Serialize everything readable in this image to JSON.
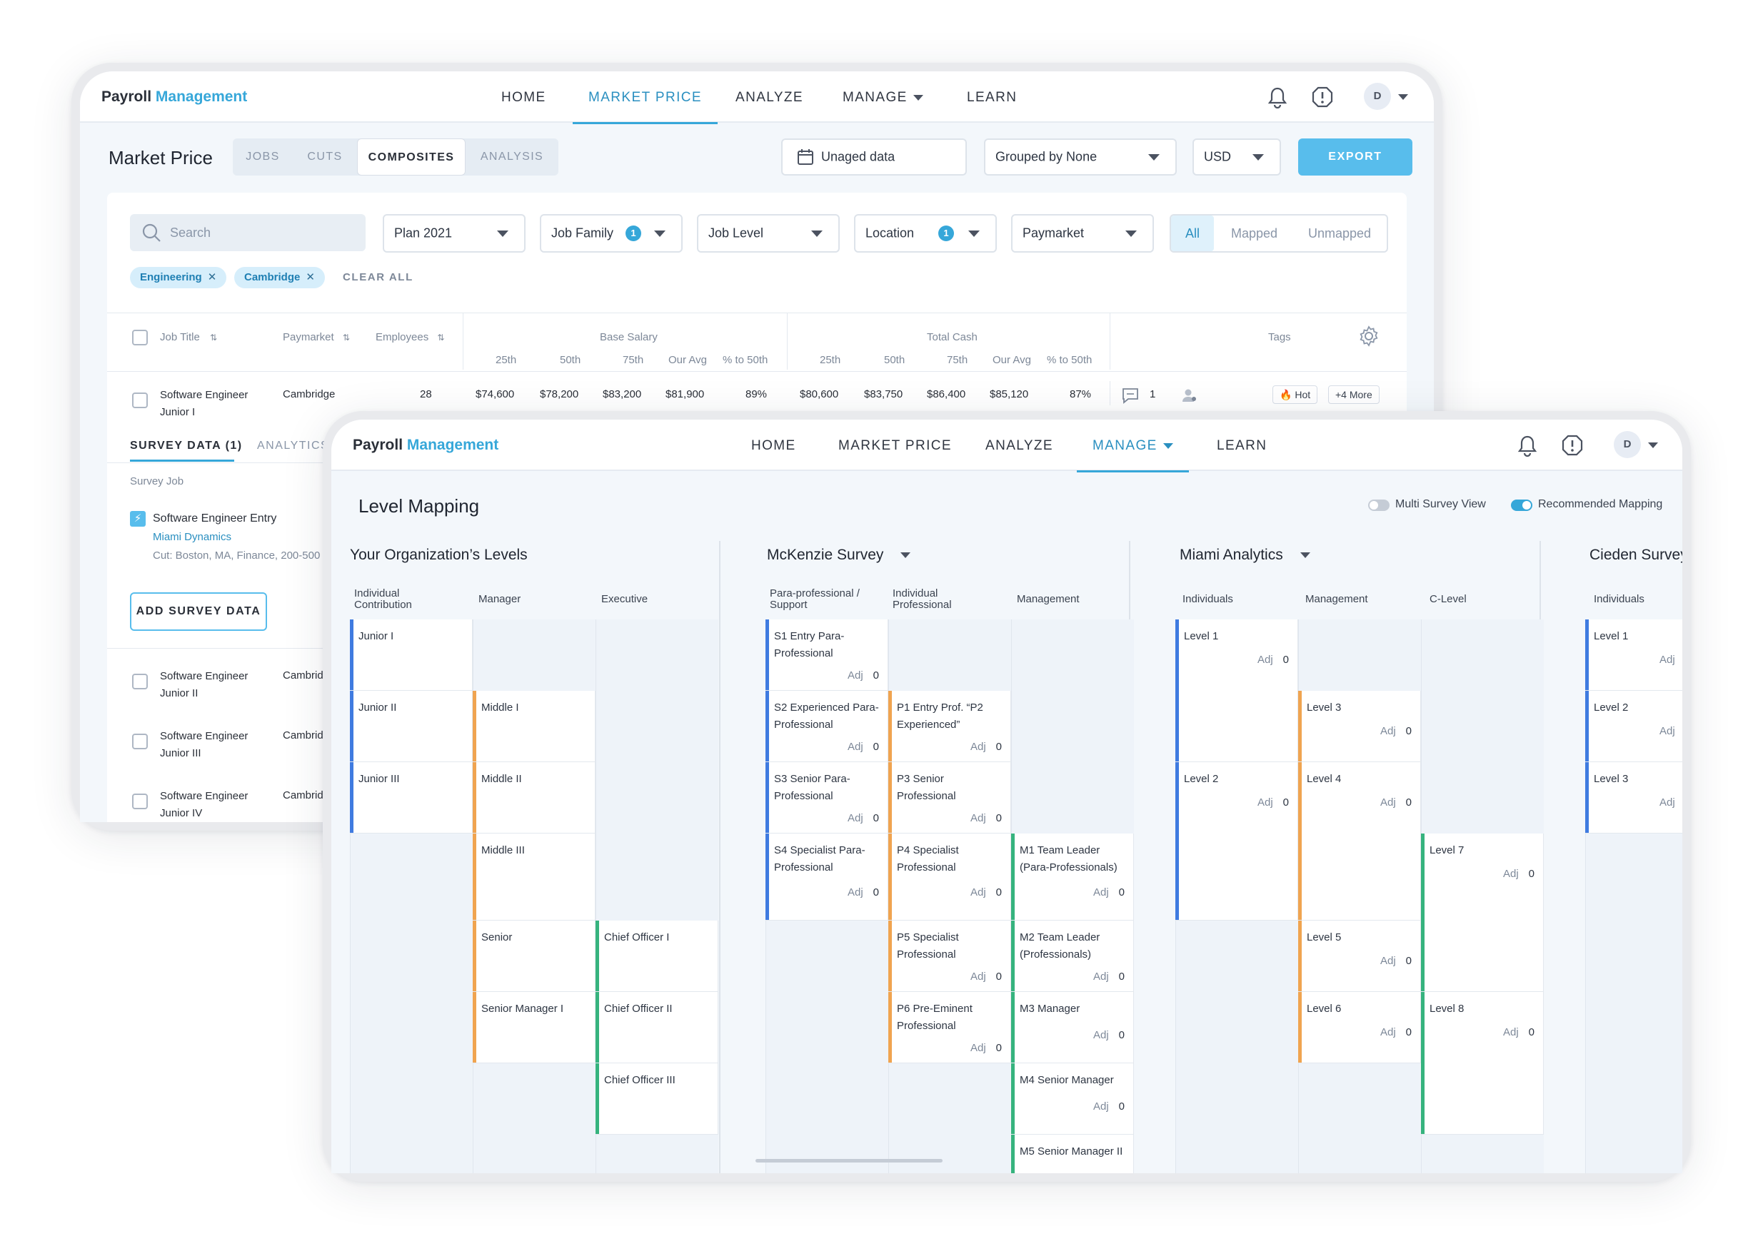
{
  "brand": {
    "part1": "Payroll",
    "part2": "Management"
  },
  "nav": {
    "home": "HOME",
    "market_price": "MARKET PRICE",
    "analyze": "ANALYZE",
    "manage": "MANAGE",
    "learn": "LEARN",
    "avatar": "D"
  },
  "market": {
    "title": "Market Price",
    "tabs": [
      "JOBS",
      "CUTS",
      "COMPOSITES",
      "ANALYSIS"
    ],
    "active_tab": "COMPOSITES",
    "unaged": "Unaged data",
    "grouped": "Grouped by None",
    "currency": "USD",
    "export": "EXPORT",
    "search_placeholder": "Search",
    "filters": {
      "plan": "Plan 2021",
      "job_family": "Job Family",
      "job_family_count": "1",
      "job_level": "Job Level",
      "location": "Location",
      "location_count": "1",
      "paymarket": "Paymarket"
    },
    "segment": [
      "All",
      "Mapped",
      "Unmapped"
    ],
    "chips": [
      "Engineering",
      "Cambridge"
    ],
    "clear_all": "CLEAR ALL",
    "table": {
      "job_title": "Job Title",
      "paymarket": "Paymarket",
      "employees": "Employees",
      "base_salary": "Base Salary",
      "total_cash": "Total Cash",
      "tags": "Tags",
      "subcols": [
        "25th",
        "50th",
        "75th",
        "Our Avg",
        "% to 50th"
      ],
      "row": {
        "title1": "Software Engineer",
        "title2": "Junior I",
        "paymarket": "Cambridge",
        "employees": "28",
        "base": [
          "$74,600",
          "$78,200",
          "$83,200",
          "$81,900",
          "89%"
        ],
        "cash": [
          "$80,600",
          "$83,750",
          "$86,400",
          "$85,120",
          "87%"
        ],
        "comments": "1",
        "tag_hot": "Hot",
        "tag_more": "+4 More"
      }
    },
    "detail": {
      "tab1": "SURVEY DATA (1)",
      "tab2": "ANALYTICS",
      "survey_job_label": "Survey Job",
      "survey_job": "Software Engineer Entry",
      "company": "Miami Dynamics",
      "cut": "Cut: Boston, MA, Finance, 200-500",
      "add_button": "ADD SURVEY DATA"
    },
    "more_rows": [
      {
        "t1": "Software Engineer",
        "t2": "Junior II",
        "pm": "Cambridge"
      },
      {
        "t1": "Software Engineer",
        "t2": "Junior III",
        "pm": "Cambridge"
      },
      {
        "t1": "Software Engineer",
        "t2": "Junior IV",
        "pm": "Cambridge"
      }
    ]
  },
  "mapping": {
    "title": "Level Mapping",
    "multi_survey": "Multi Survey View",
    "recommended": "Recommended Mapping",
    "org_title": "Your Organization’s Levels",
    "org_sub": [
      "Individual Contribution",
      "Manager",
      "Executive"
    ],
    "mck_title": "McKenzie Survey",
    "mck_sub": [
      "Para-professional / Support",
      "Individual Professional",
      "Management"
    ],
    "miami_title": "Miami Analytics",
    "miami_sub": [
      "Individuals",
      "Management",
      "C-Level"
    ],
    "cieden_title": "Cieden Survey",
    "cieden_sub": [
      "Individuals"
    ],
    "adj": "Adj",
    "zero": "0",
    "org": {
      "ic": [
        "Junior I",
        "Junior II",
        "Junior III"
      ],
      "mgr": [
        "Middle I",
        "Middle II",
        "Middle III",
        "Senior",
        "Senior Manager I"
      ],
      "exec": [
        "Chief Officer I",
        "Chief Officer II",
        "Chief Officer III"
      ]
    },
    "mck": {
      "para": [
        "S1 Entry Para-Professional",
        "S2 Experienced Para-Professional",
        "S3 Senior Para-Professional",
        "S4 Specialist Para-Professional"
      ],
      "ind": [
        "P1 Entry Prof. “P2 Experienced”",
        "P3 Senior Professional",
        "P4 Specialist Professional",
        "P5 Specialist Professional",
        "P6 Pre-Eminent Professional"
      ],
      "mgmt": [
        "M1 Team Leader (Para-Professionals)",
        "M2 Team Leader (Professionals)",
        "M3 Manager",
        "M4 Senior Manager",
        "M5 Senior Manager II"
      ]
    },
    "miami": {
      "ind": [
        "Level 1",
        "Level 2"
      ],
      "mgmt": [
        "Level 3",
        "Level 4",
        "Level 5",
        "Level 6"
      ],
      "c": [
        "Level 7",
        "Level 8"
      ]
    },
    "cieden": {
      "ind": [
        "Level 1",
        "Level 2",
        "Level 3"
      ]
    }
  },
  "colors": {
    "accent": "#36a7d9",
    "blue": "#3f7be0",
    "orange": "#f0a450",
    "green": "#36b37e"
  }
}
